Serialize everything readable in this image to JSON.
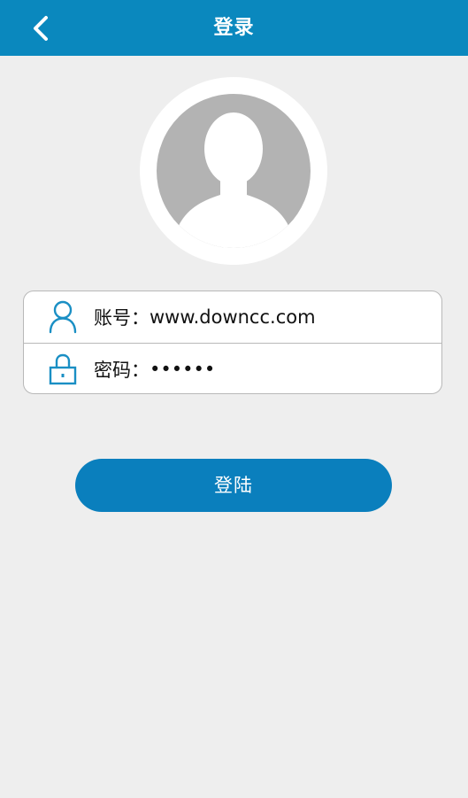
{
  "header": {
    "title": "登录"
  },
  "form": {
    "account_label": "账号：",
    "account_value": "www.downcc.com",
    "password_label": "密码：",
    "password_value": "••••••"
  },
  "actions": {
    "login_label": "登陆"
  },
  "colors": {
    "header_bg": "#0a88be",
    "accent": "#0a7fbd",
    "icon": "#1a8fc4",
    "page_bg": "#eeeeee",
    "avatar_bg": "#b3b3b3"
  },
  "icons": {
    "back": "chevron-left-icon",
    "avatar": "user-silhouette-icon",
    "account": "person-outline-icon",
    "password": "lock-icon"
  }
}
